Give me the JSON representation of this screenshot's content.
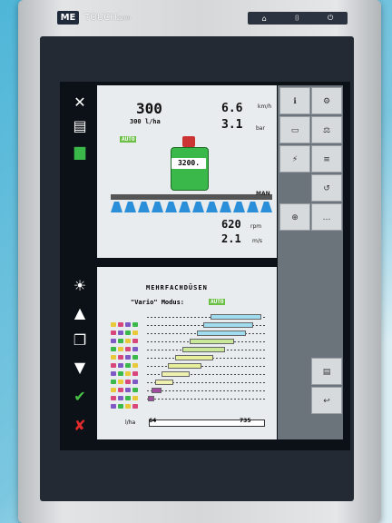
{
  "brand": {
    "logo": "ME",
    "name": "TOUCH",
    "model": "1200"
  },
  "top_buttons": [
    "⌂",
    "⌷",
    "⏻"
  ],
  "work_screen": {
    "rate_value": "300",
    "rate_actual": "300 l/ha",
    "mode_badge": "AUTO",
    "speed_value": "6.6",
    "speed_unit": "km/h",
    "pressure_value": "3.1",
    "pressure_unit": "bar",
    "tank_value": "3200.",
    "rpm_value": "620",
    "rpm_unit": "rpm",
    "flow_value": "2.1",
    "flow_unit": "m/s",
    "boom_label": "MAN"
  },
  "multi_nozzle": {
    "title": "MEHRFACHDÜSEN",
    "mode_label": "\"Vario\" Modus:",
    "mode_badge": "AUTO",
    "unit": "l/ha",
    "slider_min": "64",
    "slider_max": "735",
    "bars": [
      {
        "start": 0.54,
        "end": 0.97,
        "color": "#9fdcef"
      },
      {
        "start": 0.48,
        "end": 0.9,
        "color": "#9fdcef"
      },
      {
        "start": 0.42,
        "end": 0.84,
        "color": "#9fdcef"
      },
      {
        "start": 0.36,
        "end": 0.74,
        "color": "#c9e89a"
      },
      {
        "start": 0.3,
        "end": 0.66,
        "color": "#c9e89a"
      },
      {
        "start": 0.24,
        "end": 0.56,
        "color": "#e7ef9a"
      },
      {
        "start": 0.18,
        "end": 0.46,
        "color": "#e7ef9a"
      },
      {
        "start": 0.12,
        "end": 0.36,
        "color": "#eef0b0"
      },
      {
        "start": 0.07,
        "end": 0.22,
        "color": "#eef0b0"
      },
      {
        "start": 0.04,
        "end": 0.12,
        "color": "#a24aa0"
      },
      {
        "start": 0.01,
        "end": 0.06,
        "color": "#a24aa0"
      }
    ]
  },
  "colors": {
    "accent": "#2a8fd8",
    "tank": "#3bb84a",
    "panel": "#e9ecee"
  }
}
